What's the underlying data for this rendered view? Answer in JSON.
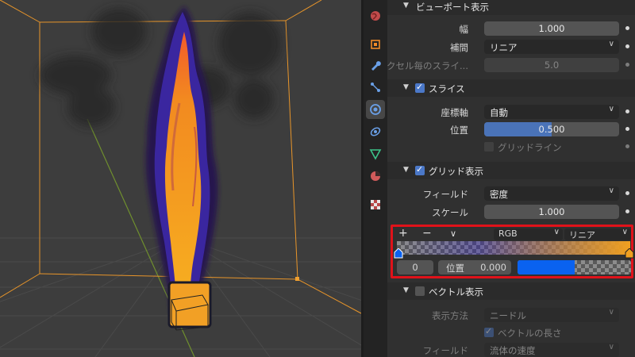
{
  "panel": {
    "viewport_display": {
      "title": "ビューポート表示",
      "rows": [
        {
          "label": "幅",
          "value": "1.000"
        },
        {
          "label": "補間",
          "value": "リニア"
        },
        {
          "label": "ボクセル毎のスライ...",
          "value": "5.0"
        }
      ]
    },
    "slice": {
      "title": "スライス",
      "axis_label": "座標軸",
      "axis_value": "自動",
      "position_label": "位置",
      "position_value": "0.500",
      "position_fraction": 0.5,
      "gridlines_label": "グリッドライン"
    },
    "grid_display": {
      "title": "グリッド表示",
      "field_label": "フィールド",
      "field_value": "密度",
      "scale_label": "スケール",
      "scale_value": "1.000"
    },
    "color_ramp": {
      "add_symbol": "+",
      "remove_symbol": "−",
      "menu_symbol": "∨",
      "color_mode": "RGB",
      "interpolation": "リニア",
      "active_index": "0",
      "position_label": "位置",
      "position_value": "0.000",
      "gradient_start": "#2a18c8",
      "gradient_end": "#f0a020",
      "stop_color": "#0a62f0"
    },
    "vector_display": {
      "title": "ベクトル表示",
      "display_method_label": "表示方法",
      "display_method_value": "ニードル",
      "vector_length_label": "ベクトルの長さ",
      "field_label": "フィールド",
      "field_value": "流体の速度"
    }
  },
  "tabs": [
    "world-icon",
    "object-icon",
    "modifier-icon",
    "particles-icon",
    "physics-icon",
    "constraints-icon",
    "data-icon",
    "material-icon",
    "texture-icon"
  ],
  "colors": {
    "accent_blue": "#4a73b8",
    "highlight_red": "#e0121a",
    "bounding_box": "#e8952a"
  }
}
